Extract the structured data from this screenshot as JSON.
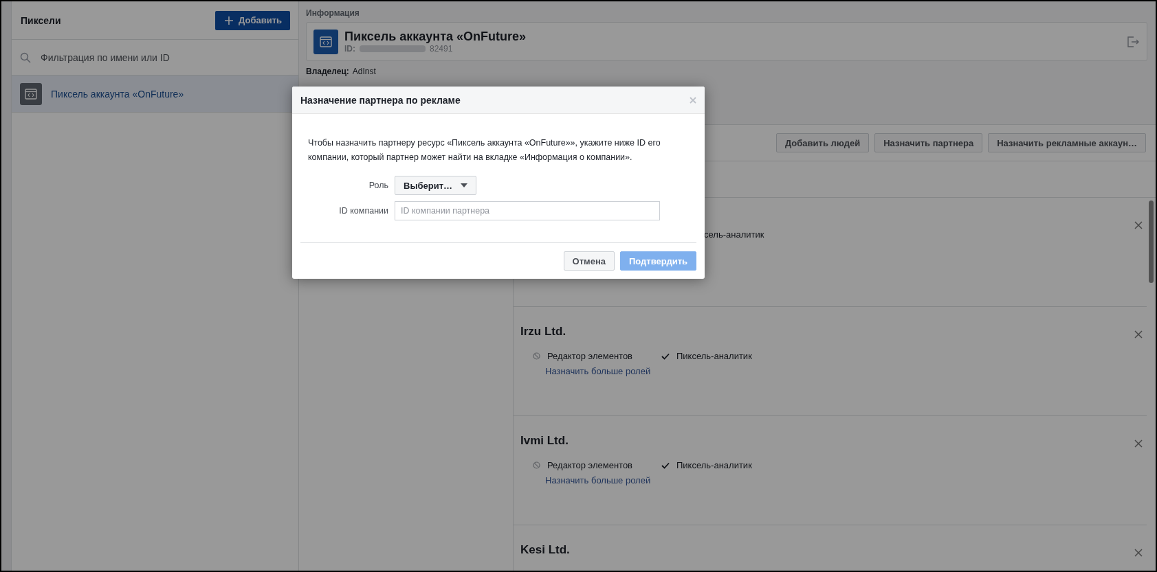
{
  "sidebar": {
    "title": "Пиксели",
    "add_button": "Добавить",
    "search": {
      "placeholder": "Фильтрация по имени или ID"
    },
    "items": [
      {
        "label": "Пиксель аккаунта «OnFuture»",
        "selected": true
      }
    ]
  },
  "info": {
    "heading": "Информация",
    "pixel_name": "Пиксель аккаунта «OnFuture»",
    "id_label": "ID:",
    "id_suffix": "82491",
    "owner_label": "Владелец:",
    "owner": "AdInst"
  },
  "toolbar_buttons": [
    "Добавить людей",
    "Назначить партнера",
    "Назначить рекламные аккаун…"
  ],
  "partners": [
    {
      "kind": "covered",
      "visible_text": "сель-аналитик"
    },
    {
      "kind": "full",
      "name": "Irzu Ltd.",
      "roles": [
        {
          "label": "Редактор элементов",
          "granted": false
        },
        {
          "label": "Пиксель-аналитик",
          "granted": true
        }
      ],
      "link": "Назначить больше ролей"
    },
    {
      "kind": "full",
      "name": "Ivmi Ltd.",
      "roles": [
        {
          "label": "Редактор элементов",
          "granted": false
        },
        {
          "label": "Пиксель-аналитик",
          "granted": true
        }
      ],
      "link": "Назначить больше ролей"
    },
    {
      "kind": "full",
      "name": "Kesi Ltd."
    }
  ],
  "modal": {
    "title": "Назначение партнера по рекламе",
    "text": "Чтобы назначить партнеру ресурс «Пиксель аккаунта «OnFuture»», укажите ниже ID его компании, который партнер может найти на вкладке «Информация о компании».",
    "role_label": "Роль",
    "role_select": "Выберит…",
    "id_label": "ID компании",
    "id_placeholder": "ID компании партнера",
    "buttons": [
      {
        "label": "Отмена",
        "kind": "secondary",
        "disabled": false
      },
      {
        "label": "Подтвердить",
        "kind": "primary",
        "disabled": true
      }
    ]
  }
}
